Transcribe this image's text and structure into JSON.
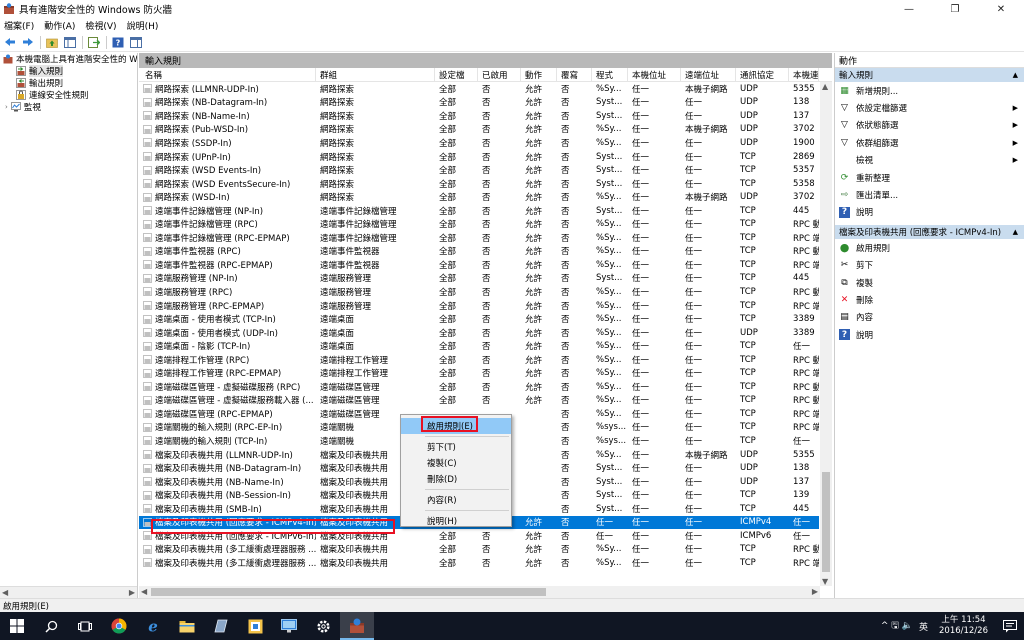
{
  "window": {
    "title": "具有進階安全性的 Windows 防火牆",
    "minimize": "—",
    "maximize": "❐",
    "close": "✕"
  },
  "menu": [
    "檔案(F)",
    "動作(A)",
    "檢視(V)",
    "說明(H)"
  ],
  "tree": {
    "root": "本機電腦上具有進階安全性的 Windows 防火牆",
    "items": [
      "輸入規則",
      "輸出規則",
      "連線安全性規則",
      "監視"
    ]
  },
  "center": {
    "header": "輸入規則",
    "columns": [
      "名稱",
      "群組",
      "設定檔",
      "已啟用",
      "動作",
      "覆寫",
      "程式",
      "本機位址",
      "遠端位址",
      "通訊協定",
      "本機連"
    ],
    "rows": [
      [
        "網路探索 (LLMNR-UDP-In)",
        "網路探索",
        "全部",
        "否",
        "允許",
        "否",
        "%Sy...",
        "任一",
        "本機子網路",
        "UDP",
        "5355"
      ],
      [
        "網路探索 (NB-Datagram-In)",
        "網路探索",
        "全部",
        "否",
        "允許",
        "否",
        "Syst...",
        "任一",
        "任一",
        "UDP",
        "138"
      ],
      [
        "網路探索 (NB-Name-In)",
        "網路探索",
        "全部",
        "否",
        "允許",
        "否",
        "Syst...",
        "任一",
        "任一",
        "UDP",
        "137"
      ],
      [
        "網路探索 (Pub-WSD-In)",
        "網路探索",
        "全部",
        "否",
        "允許",
        "否",
        "%Sy...",
        "任一",
        "本機子網路",
        "UDP",
        "3702"
      ],
      [
        "網路探索 (SSDP-In)",
        "網路探索",
        "全部",
        "否",
        "允許",
        "否",
        "%Sy...",
        "任一",
        "任一",
        "UDP",
        "1900"
      ],
      [
        "網路探索 (UPnP-In)",
        "網路探索",
        "全部",
        "否",
        "允許",
        "否",
        "Syst...",
        "任一",
        "任一",
        "TCP",
        "2869"
      ],
      [
        "網路探索 (WSD Events-In)",
        "網路探索",
        "全部",
        "否",
        "允許",
        "否",
        "Syst...",
        "任一",
        "任一",
        "TCP",
        "5357"
      ],
      [
        "網路探索 (WSD EventsSecure-In)",
        "網路探索",
        "全部",
        "否",
        "允許",
        "否",
        "Syst...",
        "任一",
        "任一",
        "TCP",
        "5358"
      ],
      [
        "網路探索 (WSD-In)",
        "網路探索",
        "全部",
        "否",
        "允許",
        "否",
        "%Sy...",
        "任一",
        "本機子網路",
        "UDP",
        "3702"
      ],
      [
        "遠端事件記錄檔管理 (NP-In)",
        "遠端事件記錄檔管理",
        "全部",
        "否",
        "允許",
        "否",
        "Syst...",
        "任一",
        "任一",
        "TCP",
        "445"
      ],
      [
        "遠端事件記錄檔管理 (RPC)",
        "遠端事件記錄檔管理",
        "全部",
        "否",
        "允許",
        "否",
        "%Sy...",
        "任一",
        "任一",
        "TCP",
        "RPC 動"
      ],
      [
        "遠端事件記錄檔管理 (RPC-EPMAP)",
        "遠端事件記錄檔管理",
        "全部",
        "否",
        "允許",
        "否",
        "%Sy...",
        "任一",
        "任一",
        "TCP",
        "RPC 端"
      ],
      [
        "遠端事件監視器 (RPC)",
        "遠端事件監視器",
        "全部",
        "否",
        "允許",
        "否",
        "%Sy...",
        "任一",
        "任一",
        "TCP",
        "RPC 動"
      ],
      [
        "遠端事件監視器 (RPC-EPMAP)",
        "遠端事件監視器",
        "全部",
        "否",
        "允許",
        "否",
        "%Sy...",
        "任一",
        "任一",
        "TCP",
        "RPC 端"
      ],
      [
        "遠端服務管理 (NP-In)",
        "遠端服務管理",
        "全部",
        "否",
        "允許",
        "否",
        "Syst...",
        "任一",
        "任一",
        "TCP",
        "445"
      ],
      [
        "遠端服務管理 (RPC)",
        "遠端服務管理",
        "全部",
        "否",
        "允許",
        "否",
        "%Sy...",
        "任一",
        "任一",
        "TCP",
        "RPC 動"
      ],
      [
        "遠端服務管理 (RPC-EPMAP)",
        "遠端服務管理",
        "全部",
        "否",
        "允許",
        "否",
        "%Sy...",
        "任一",
        "任一",
        "TCP",
        "RPC 端"
      ],
      [
        "遠端桌面 - 使用者模式 (TCP-In)",
        "遠端桌面",
        "全部",
        "否",
        "允許",
        "否",
        "%Sy...",
        "任一",
        "任一",
        "TCP",
        "3389"
      ],
      [
        "遠端桌面 - 使用者模式 (UDP-In)",
        "遠端桌面",
        "全部",
        "否",
        "允許",
        "否",
        "%Sy...",
        "任一",
        "任一",
        "UDP",
        "3389"
      ],
      [
        "遠端桌面 - 陰影 (TCP-In)",
        "遠端桌面",
        "全部",
        "否",
        "允許",
        "否",
        "%Sy...",
        "任一",
        "任一",
        "TCP",
        "任一"
      ],
      [
        "遠端排程工作管理 (RPC)",
        "遠端排程工作管理",
        "全部",
        "否",
        "允許",
        "否",
        "%Sy...",
        "任一",
        "任一",
        "TCP",
        "RPC 動"
      ],
      [
        "遠端排程工作管理 (RPC-EPMAP)",
        "遠端排程工作管理",
        "全部",
        "否",
        "允許",
        "否",
        "%Sy...",
        "任一",
        "任一",
        "TCP",
        "RPC 端"
      ],
      [
        "遠端磁碟區管理 - 虛擬磁碟服務 (RPC)",
        "遠端磁碟區管理",
        "全部",
        "否",
        "允許",
        "否",
        "%Sy...",
        "任一",
        "任一",
        "TCP",
        "RPC 動"
      ],
      [
        "遠端磁碟區管理 - 虛擬磁碟服務載入器 (...",
        "遠端磁碟區管理",
        "全部",
        "否",
        "允許",
        "否",
        "%Sy...",
        "任一",
        "任一",
        "TCP",
        "RPC 動"
      ],
      [
        "遠端磁碟區管理 (RPC-EPMAP)",
        "遠端磁碟區管理",
        "",
        "",
        "",
        "否",
        "%Sy...",
        "任一",
        "任一",
        "TCP",
        "RPC 端"
      ],
      [
        "遠端關機的輸入規則 (RPC-EP-In)",
        "遠端關機",
        "",
        "",
        "",
        "否",
        "%sys...",
        "任一",
        "任一",
        "TCP",
        "RPC 端"
      ],
      [
        "遠端關機的輸入規則 (TCP-In)",
        "遠端關機",
        "",
        "",
        "",
        "否",
        "%sys...",
        "任一",
        "任一",
        "TCP",
        "任一"
      ],
      [
        "檔案及印表機共用 (LLMNR-UDP-In)",
        "檔案及印表機共用",
        "",
        "",
        "",
        "否",
        "%Sy...",
        "任一",
        "本機子網路",
        "UDP",
        "5355"
      ],
      [
        "檔案及印表機共用 (NB-Datagram-In)",
        "檔案及印表機共用",
        "",
        "",
        "",
        "否",
        "Syst...",
        "任一",
        "任一",
        "UDP",
        "138"
      ],
      [
        "檔案及印表機共用 (NB-Name-In)",
        "檔案及印表機共用",
        "",
        "",
        "",
        "否",
        "Syst...",
        "任一",
        "任一",
        "UDP",
        "137"
      ],
      [
        "檔案及印表機共用 (NB-Session-In)",
        "檔案及印表機共用",
        "",
        "",
        "",
        "否",
        "Syst...",
        "任一",
        "任一",
        "TCP",
        "139"
      ],
      [
        "檔案及印表機共用 (SMB-In)",
        "檔案及印表機共用",
        "",
        "",
        "",
        "否",
        "Syst...",
        "任一",
        "任一",
        "TCP",
        "445"
      ],
      [
        "檔案及印表機共用 (回應要求 - ICMPv4-In)",
        "檔案及印表機共用",
        "",
        "",
        "允許",
        "否",
        "任一",
        "任一",
        "任一",
        "ICMPv4",
        "任一"
      ],
      [
        "檔案及印表機共用 (回應要求 - ICMPv6-In)",
        "檔案及印表機共用",
        "全部",
        "否",
        "允許",
        "否",
        "任一",
        "任一",
        "任一",
        "ICMPv6",
        "任一"
      ],
      [
        "檔案及印表機共用 (多工緩衝處理器服務 ...",
        "檔案及印表機共用",
        "全部",
        "否",
        "允許",
        "否",
        "%Sy...",
        "任一",
        "任一",
        "TCP",
        "RPC 動"
      ],
      [
        "檔案及印表機共用 (多工緩衝處理器服務 ...",
        "檔案及印表機共用",
        "全部",
        "否",
        "允許",
        "否",
        "%Sy...",
        "任一",
        "任一",
        "TCP",
        "RPC 端"
      ]
    ]
  },
  "context_menu": [
    "啟用規則(E)",
    "剪下(T)",
    "複製(C)",
    "刪除(D)",
    "內容(R)",
    "說明(H)"
  ],
  "actions": {
    "title": "動作",
    "group1": "輸入規則",
    "group1_items": [
      "新增規則...",
      "依設定檔篩選",
      "依狀態篩選",
      "依群組篩選",
      "檢視",
      "重新整理",
      "匯出清單...",
      "說明"
    ],
    "group2": "檔案及印表機共用 (回應要求 - ICMPv4-In)",
    "group2_items": [
      "啟用規則",
      "剪下",
      "複製",
      "刪除",
      "內容",
      "說明"
    ]
  },
  "status": "啟用規則(E)",
  "taskbar": {
    "ime": "英",
    "time": "上午 11:54",
    "date": "2016/12/26",
    "tray_symbols": "^ 🖫 🔈"
  }
}
